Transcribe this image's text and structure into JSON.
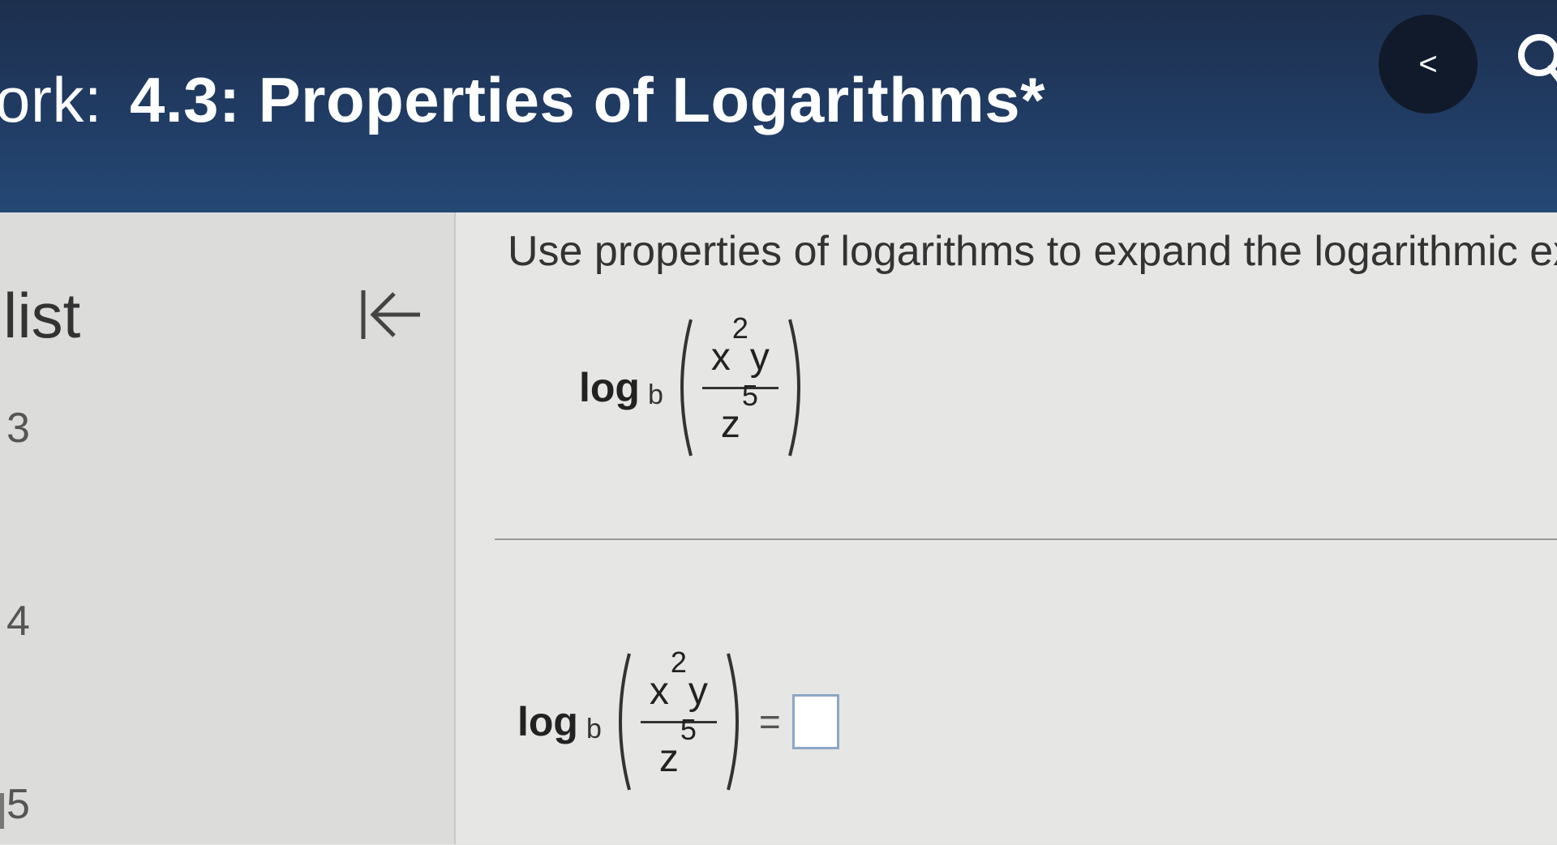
{
  "header": {
    "title_prefix": "ork:",
    "title": "4.3: Properties of Logarithms*",
    "back_label": "<",
    "accent_color": "#213d66"
  },
  "sidebar": {
    "title": "list",
    "items": [
      {
        "label": "3"
      },
      {
        "label": "4"
      },
      {
        "label": "5"
      }
    ]
  },
  "main": {
    "instructions": "Use properties of logarithms to expand the logarithmic exp",
    "expression": {
      "log": "log",
      "base": "b",
      "numerator_base": "x",
      "numerator_exp": "2",
      "numerator_var": "y",
      "denominator_base": "z",
      "denominator_exp": "5"
    },
    "answer": {
      "equals": "=",
      "value": ""
    }
  }
}
